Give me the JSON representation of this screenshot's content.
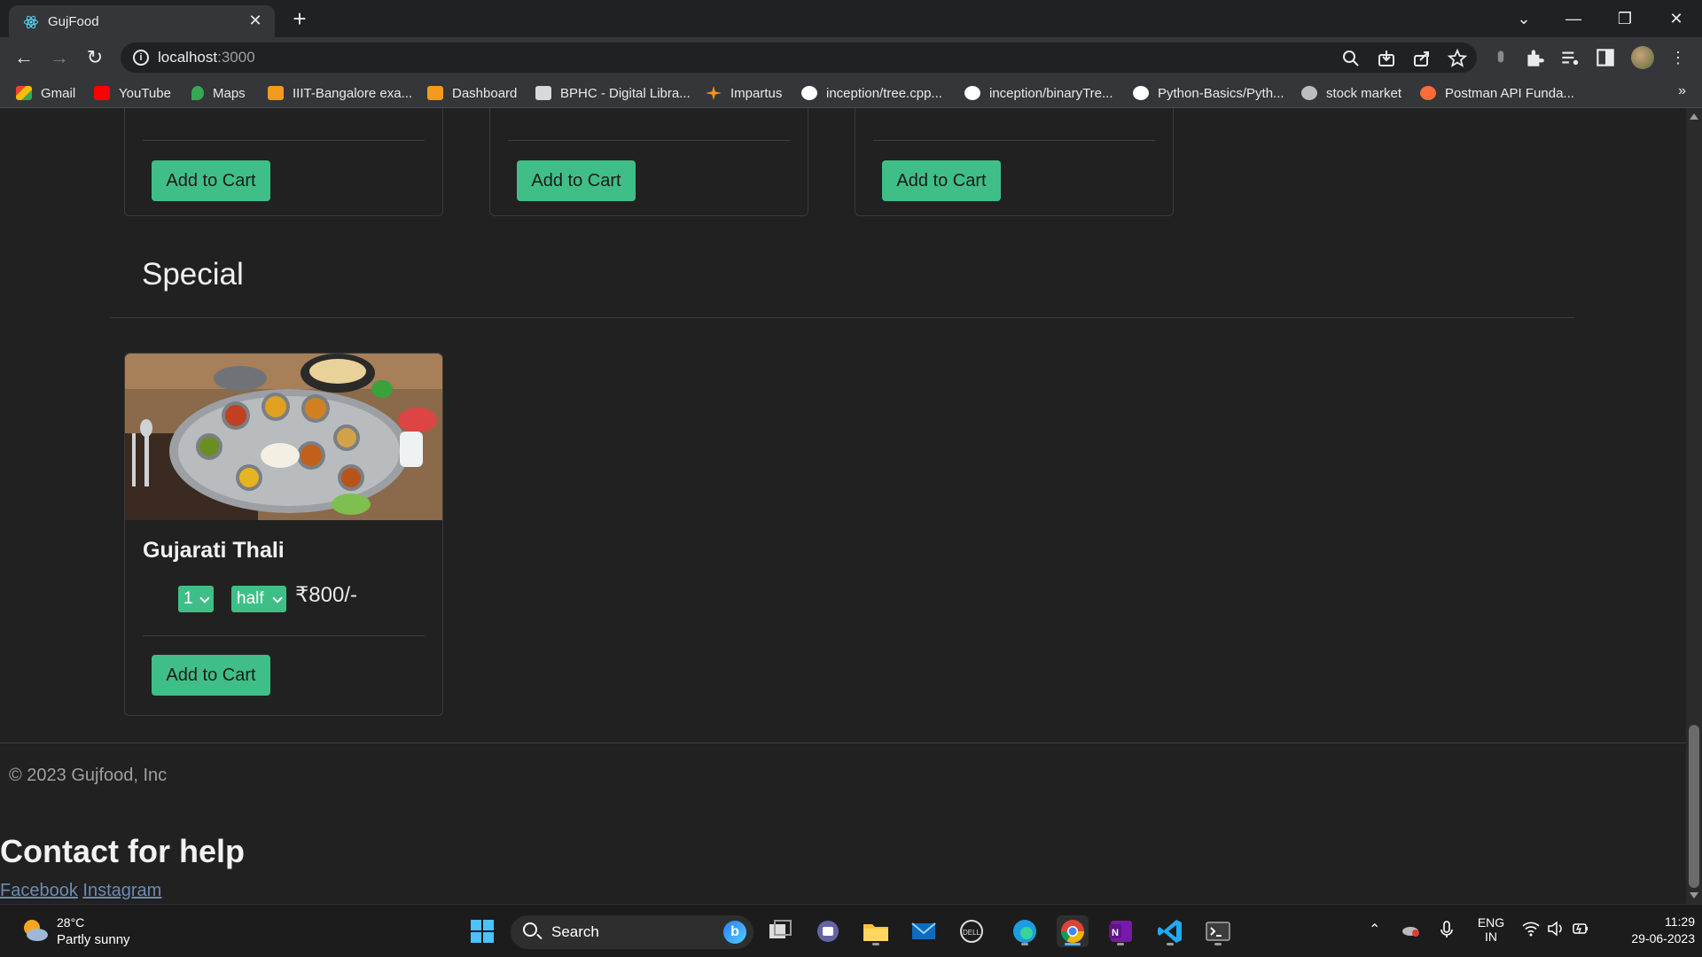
{
  "browser": {
    "tab_title": "GujFood",
    "tab_close": "✕",
    "new_tab": "+",
    "url_host": "localhost",
    "url_port": ":3000",
    "window_controls": {
      "chevron": "⌄",
      "minimize": "—",
      "restore": "❐",
      "close": "✕"
    },
    "bookmarks": [
      {
        "label": "Gmail",
        "icon": "gmail-icon",
        "color": "#ea4335"
      },
      {
        "label": "YouTube",
        "icon": "youtube-icon",
        "color": "#ff0000"
      },
      {
        "label": "Maps",
        "icon": "maps-icon",
        "color": "#34a853"
      },
      {
        "label": "IIIT-Bangalore exa...",
        "icon": "iiitb-icon",
        "color": "#f29b1d"
      },
      {
        "label": "Dashboard",
        "icon": "dashboard-icon",
        "color": "#f29b1d"
      },
      {
        "label": "BPHC - Digital Libra...",
        "icon": "bphc-icon",
        "color": "#d9d9d9"
      },
      {
        "label": "Impartus",
        "icon": "impartus-icon",
        "color": "#f7931e"
      },
      {
        "label": "inception/tree.cpp...",
        "icon": "github-icon",
        "color": "#ffffff"
      },
      {
        "label": "inception/binaryTre...",
        "icon": "github-icon",
        "color": "#ffffff"
      },
      {
        "label": "Python-Basics/Pyth...",
        "icon": "github-icon",
        "color": "#ffffff"
      },
      {
        "label": "stock market",
        "icon": "globe-icon",
        "color": "#bdbdbd"
      },
      {
        "label": "Postman API Funda...",
        "icon": "postman-icon",
        "color": "#ff6c37"
      }
    ],
    "bookmarks_more": "»"
  },
  "page": {
    "top_cards": [
      {
        "button_label": "Add to Cart"
      },
      {
        "button_label": "Add to Cart"
      },
      {
        "button_label": "Add to Cart"
      }
    ],
    "section_title": "Special",
    "special_item": {
      "name": "Gujarati Thali",
      "quantity": "1",
      "portion": "half",
      "price": "₹800/-",
      "button_label": "Add to Cart"
    },
    "footer": {
      "copyright": "© 2023 Gujfood, Inc",
      "contact_title": "Contact for help",
      "links": [
        "Facebook",
        "Instagram"
      ]
    }
  },
  "taskbar": {
    "weather_temp": "28°C",
    "weather_desc": "Partly sunny",
    "search_label": "Search",
    "lang_top": "ENG",
    "lang_bottom": "IN",
    "time": "11:29",
    "date": "29-06-2023"
  },
  "colors": {
    "accent_green": "#3fbf87",
    "page_bg": "#212121"
  }
}
